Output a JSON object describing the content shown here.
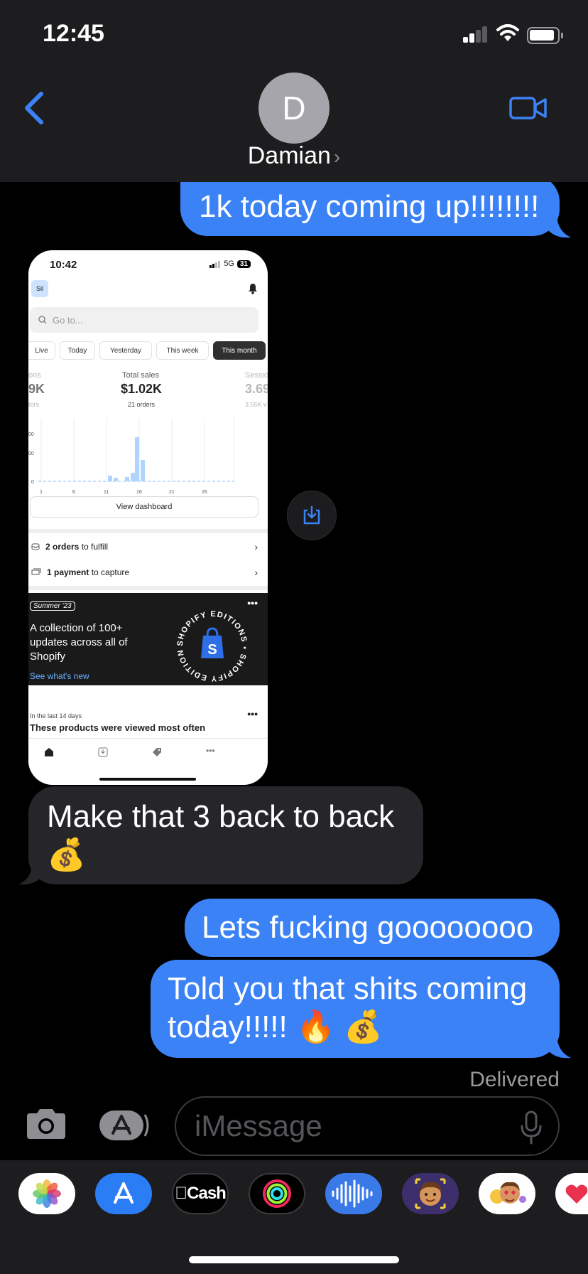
{
  "status_bar": {
    "time": "12:45"
  },
  "contact": {
    "initial": "D",
    "name": "Damian"
  },
  "messages": {
    "m1": {
      "text": "1k today coming up!!!!!!!!"
    },
    "m2": {
      "text": "Make that 3 back to back 💰"
    },
    "m3": {
      "text": "Lets fucking goooooooo"
    },
    "m4": {
      "text": "Told you that shits coming today!!!!! 🔥 💰"
    },
    "delivered": "Delivered"
  },
  "shopify": {
    "time": "10:42",
    "network": "5G",
    "battery": "31",
    "store_initials": "Sil",
    "search_placeholder": "Go to...",
    "tabs": [
      "Live",
      "Today",
      "Yesterday",
      "This week",
      "This month"
    ],
    "left_metric": {
      "label": "ons",
      "value": "9K",
      "sub": "tors"
    },
    "total_sales": {
      "label": "Total sales",
      "value": "$1.02K",
      "sub": "21 orders"
    },
    "right_metric": {
      "label": "Sessio",
      "value": "3.69",
      "sub": "3.55K v"
    },
    "chart_y_ticks": [
      "00",
      "00",
      "0"
    ],
    "chart_x_ticks": [
      "1",
      "6",
      "11",
      "16",
      "21",
      "26"
    ],
    "view_dashboard": "View dashboard",
    "fulfill": {
      "bold": "2 orders",
      "rest": " to fulfill"
    },
    "payment": {
      "bold": "1 payment",
      "rest": " to capture"
    },
    "promo": {
      "tag": "Summer '23",
      "title": "A collection of 100+ updates across all of Shopify",
      "link": "See what's new",
      "seal_text": "SHOPIFY EDITIONS • SHOPIFY EDITIONS •"
    },
    "recent_label": "In the last 14 days",
    "recent_title": "These products were viewed most often",
    "dots": "•••"
  },
  "input": {
    "placeholder": "iMessage"
  },
  "drawer": {
    "cash_label": "Cash"
  },
  "colors": {
    "bubble_out": "#3b82f6",
    "bubble_in": "#26262a",
    "accent": "#3b82f6"
  }
}
